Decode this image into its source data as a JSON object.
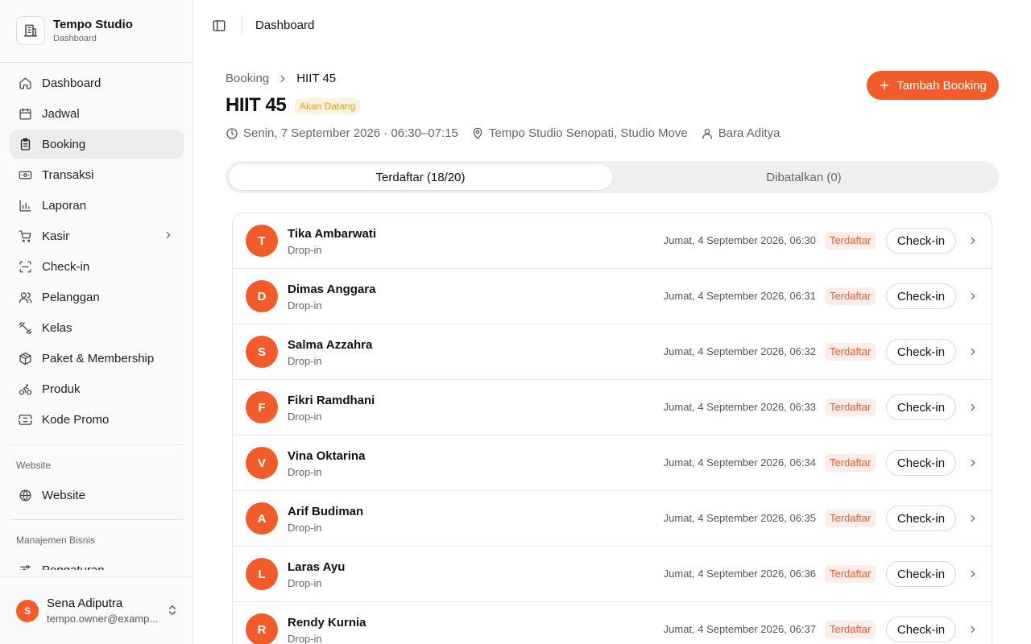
{
  "brand": {
    "title": "Tempo Studio",
    "subtitle": "Dashboard"
  },
  "sidebar": {
    "items": [
      {
        "label": "Dashboard",
        "icon": "home-icon"
      },
      {
        "label": "Jadwal",
        "icon": "calendar-icon"
      },
      {
        "label": "Booking",
        "icon": "clipboard-icon",
        "active": true
      },
      {
        "label": "Transaksi",
        "icon": "banknote-icon"
      },
      {
        "label": "Laporan",
        "icon": "bar-chart-icon"
      },
      {
        "label": "Kasir",
        "icon": "cart-icon",
        "has_submenu": true
      },
      {
        "label": "Check-in",
        "icon": "scan-icon"
      },
      {
        "label": "Pelanggan",
        "icon": "users-icon"
      },
      {
        "label": "Kelas",
        "icon": "dumbbell-icon"
      },
      {
        "label": "Paket & Membership",
        "icon": "package-icon"
      },
      {
        "label": "Produk",
        "icon": "bike-icon"
      },
      {
        "label": "Kode Promo",
        "icon": "ticket-icon"
      }
    ],
    "website_group": {
      "label": "Website",
      "items": [
        {
          "label": "Website",
          "icon": "globe-icon"
        }
      ]
    },
    "business_group": {
      "label": "Manajemen Bisnis",
      "items": [
        {
          "label": "Pengaturan",
          "icon": "settings-icon"
        }
      ]
    }
  },
  "user": {
    "initial": "S",
    "name": "Sena Adiputra",
    "email": "tempo.owner@examp..."
  },
  "topbar": {
    "title": "Dashboard"
  },
  "breadcrumb": {
    "parent": "Booking",
    "current": "HIIT 45"
  },
  "page": {
    "title": "HIIT 45",
    "status": "Akan Datang",
    "datetime": "Senin, 7 September 2026 · 06:30–07:15",
    "location": "Tempo Studio Senopati, Studio Move",
    "instructor": "Bara Aditya",
    "add_button": "Tambah Booking"
  },
  "tabs": {
    "registered": "Terdaftar (18/20)",
    "cancelled": "Dibatalkan (0)"
  },
  "bookings": [
    {
      "initial": "T",
      "name": "Tika Ambarwati",
      "type": "Drop-in",
      "date": "Jumat, 4 September 2026, 06:30",
      "status": "Terdaftar",
      "action": "Check-in"
    },
    {
      "initial": "D",
      "name": "Dimas Anggara",
      "type": "Drop-in",
      "date": "Jumat, 4 September 2026, 06:31",
      "status": "Terdaftar",
      "action": "Check-in"
    },
    {
      "initial": "S",
      "name": "Salma Azzahra",
      "type": "Drop-in",
      "date": "Jumat, 4 September 2026, 06:32",
      "status": "Terdaftar",
      "action": "Check-in"
    },
    {
      "initial": "F",
      "name": "Fikri Ramdhani",
      "type": "Drop-in",
      "date": "Jumat, 4 September 2026, 06:33",
      "status": "Terdaftar",
      "action": "Check-in"
    },
    {
      "initial": "V",
      "name": "Vina Oktarina",
      "type": "Drop-in",
      "date": "Jumat, 4 September 2026, 06:34",
      "status": "Terdaftar",
      "action": "Check-in"
    },
    {
      "initial": "A",
      "name": "Arif Budiman",
      "type": "Drop-in",
      "date": "Jumat, 4 September 2026, 06:35",
      "status": "Terdaftar",
      "action": "Check-in"
    },
    {
      "initial": "L",
      "name": "Laras Ayu",
      "type": "Drop-in",
      "date": "Jumat, 4 September 2026, 06:36",
      "status": "Terdaftar",
      "action": "Check-in"
    },
    {
      "initial": "R",
      "name": "Rendy Kurnia",
      "type": "Drop-in",
      "date": "Jumat, 4 September 2026, 06:37",
      "status": "Terdaftar",
      "action": "Check-in"
    }
  ],
  "colors": {
    "accent": "#f25c2b",
    "status_upcoming_bg": "#fdf3dd",
    "status_upcoming_text": "#e8a21b",
    "badge_bg": "#fdece7"
  }
}
